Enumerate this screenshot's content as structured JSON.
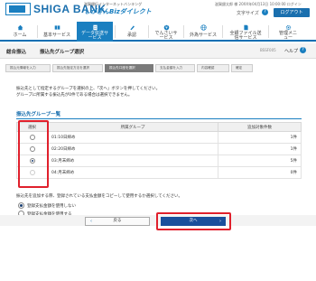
{
  "header": {
    "logo": "SHIGA BANK",
    "biz_subtitle": "滋賀銀行インターネットバンキング",
    "biz_brand": "しがぎんBizダイレクト",
    "user_info": "滋賀銀太郎 様 20XX年04月13日 10:00:00 ログイン",
    "font_size_label": "文字サイズ",
    "help_icon": "question-icon",
    "logout_label": "ログアウト"
  },
  "nav": {
    "items": [
      {
        "label": "ホーム",
        "icon": "home-icon"
      },
      {
        "label": "基本サービス",
        "icon": "book-icon"
      },
      {
        "label": "データ伝送サービス",
        "icon": "document-icon",
        "active": true
      },
      {
        "label": "承認",
        "icon": "pen-icon"
      },
      {
        "label": "でんさいサービス",
        "icon": "yen-icon"
      },
      {
        "label": "外為サービス",
        "icon": "globe-icon"
      },
      {
        "label": "全銀ファイル送信サービス",
        "icon": "file-icon"
      },
      {
        "label": "管理メニュー",
        "icon": "gear-icon"
      }
    ]
  },
  "titlebar": {
    "crumb": "総合振込",
    "title": "振込先グループ選択",
    "screen_id": "BSSF005",
    "help": "ヘルプ"
  },
  "steps": [
    "振込元情報を入力",
    "振込先指定方法を選択",
    "振込先口座を選択",
    "支払金額を入力",
    "内容確認",
    "確定"
  ],
  "instructions": [
    "振込先として指定するグループを選択の上、「次へ」ボタンを押してください。",
    "グループに所属する振込先が0件である場合は選択できません。"
  ],
  "section_title": "振込先グループ一覧",
  "table": {
    "headers": [
      "選択",
      "所属グループ",
      "追加対象件数"
    ],
    "rows": [
      {
        "selected": false,
        "group": "01:10日締め",
        "count": "1件"
      },
      {
        "selected": false,
        "group": "02:20日締め",
        "count": "1件"
      },
      {
        "selected": true,
        "group": "03:月末締め",
        "count": "5件"
      },
      {
        "selected": false,
        "group": "04:月末締め",
        "count": "0件"
      }
    ]
  },
  "options": {
    "prompt": "振込先を追加する際、登録されている支払金額をコピーして使用するか選択してください。",
    "items": [
      {
        "label": "登録支払金額を使用しない",
        "selected": true
      },
      {
        "label": "登録支払金額を使用する",
        "selected": false
      }
    ]
  },
  "buttons": {
    "back": "戻る",
    "next": "次へ"
  },
  "colors": {
    "brand_blue": "#1a7fc0",
    "highlight_red": "#e0202c",
    "next_button": "#1a4f9c"
  }
}
